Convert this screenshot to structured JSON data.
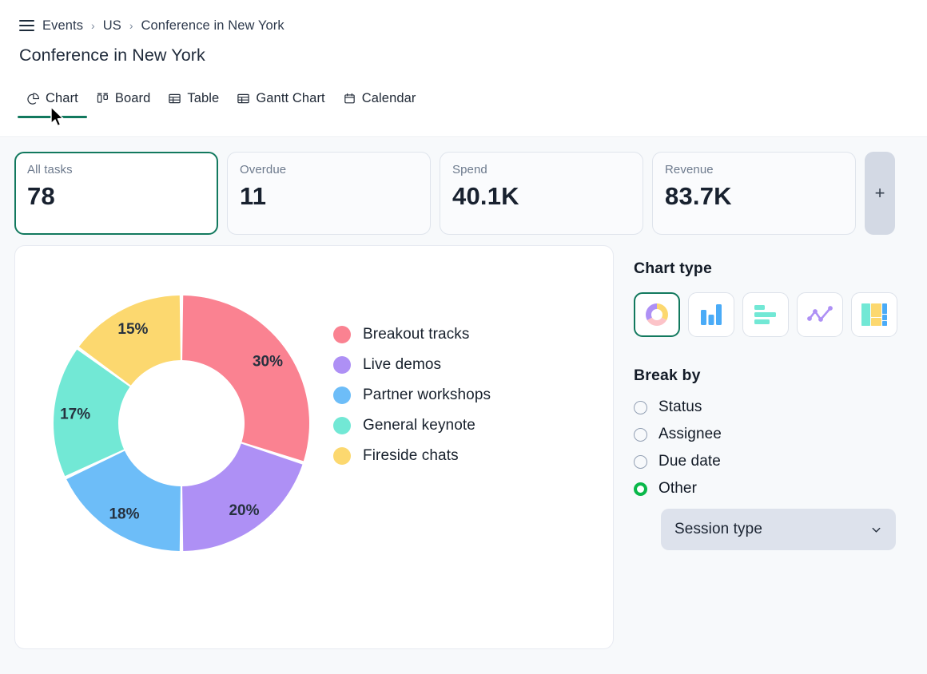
{
  "header": {
    "menu_icon": "hamburger-icon",
    "breadcrumb": [
      {
        "label": "Events"
      },
      {
        "label": "US"
      },
      {
        "label": "Conference in New York"
      }
    ],
    "breadcrumb_separator": "›",
    "title": "Conference in New York"
  },
  "tabs": [
    {
      "label": "Chart",
      "icon": "pie-chart-icon",
      "active": true
    },
    {
      "label": "Board",
      "icon": "board-icon",
      "active": false
    },
    {
      "label": "Table",
      "icon": "table-icon",
      "active": false
    },
    {
      "label": "Gantt Chart",
      "icon": "gantt-icon",
      "active": false
    },
    {
      "label": "Calendar",
      "icon": "calendar-icon",
      "active": false
    }
  ],
  "kpis": [
    {
      "label": "All tasks",
      "value": "78",
      "selected": true
    },
    {
      "label": "Overdue",
      "value": "11",
      "selected": false
    },
    {
      "label": "Spend",
      "value": "40.1K",
      "selected": false
    },
    {
      "label": "Revenue",
      "value": "83.7K",
      "selected": false
    }
  ],
  "add_kpi_button": {
    "label": "+",
    "icon": "plus-icon"
  },
  "chart_data": {
    "type": "pie",
    "title": "",
    "variant": "donut",
    "legend_position": "right",
    "categories": [
      "Breakout tracks",
      "Live demos",
      "Partner workshops",
      "General keynote",
      "Fireside chats"
    ],
    "values": [
      30,
      20,
      18,
      17,
      15
    ],
    "labels": [
      "30%",
      "20%",
      "18%",
      "17%",
      "15%"
    ],
    "colors": [
      "#fa8291",
      "#ae90f5",
      "#6dbdf8",
      "#72e8d5",
      "#fcd86f"
    ],
    "units": "percent"
  },
  "side_panel": {
    "chart_type": {
      "heading": "Chart type",
      "options": [
        {
          "icon": "donut-chart-icon",
          "name": "Donut",
          "selected": true
        },
        {
          "icon": "bar-chart-icon",
          "name": "Bar",
          "selected": false
        },
        {
          "icon": "hbar-chart-icon",
          "name": "Horizontal bar",
          "selected": false
        },
        {
          "icon": "line-chart-icon",
          "name": "Line",
          "selected": false
        },
        {
          "icon": "treemap-chart-icon",
          "name": "Treemap",
          "selected": false
        }
      ]
    },
    "break_by": {
      "heading": "Break by",
      "options": [
        {
          "label": "Status",
          "selected": false
        },
        {
          "label": "Assignee",
          "selected": false
        },
        {
          "label": "Due date",
          "selected": false
        },
        {
          "label": "Other",
          "selected": true
        }
      ],
      "other_select": {
        "value": "Session type",
        "chevron": "chevron-down-icon"
      }
    }
  },
  "colors": {
    "accent_green": "#12795e",
    "radio_green": "#0ab84a",
    "page_bg": "#f7f9fb",
    "card_bg": "#ffffff"
  }
}
